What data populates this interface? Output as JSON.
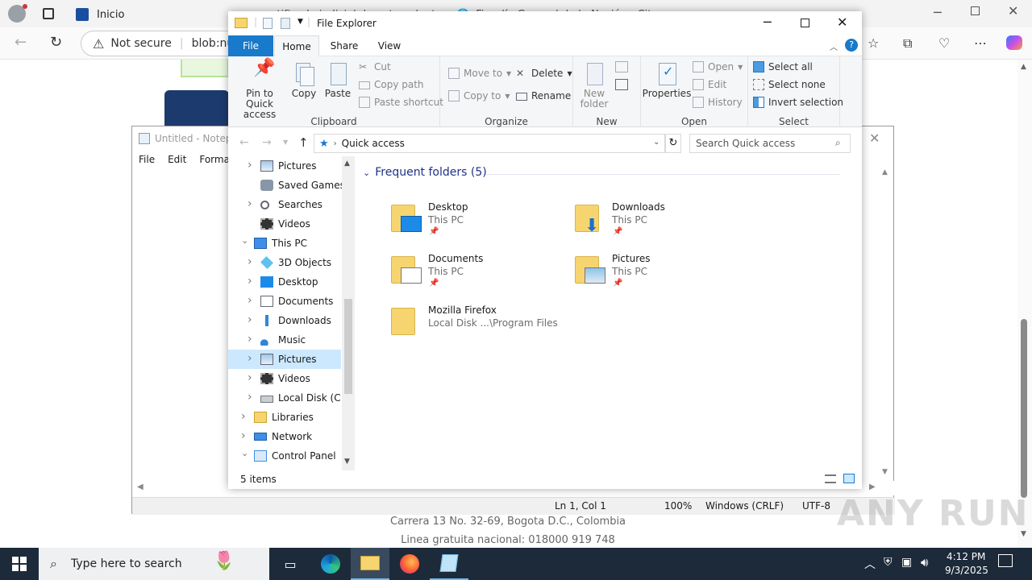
{
  "browser": {
    "tabs": [
      {
        "label": "Inicio"
      },
      {
        "label": "ertificado judicial de antecedentes"
      },
      {
        "label": "Fiscalía General de la Nación - Cit"
      }
    ],
    "security_label": "Not secure",
    "url": "blob:nu",
    "page_footer": {
      "address": "Carrera 13 No. 32-69, Bogota D.C., Colombia",
      "phone": "Linea gratuita nacional: 018000 919 748"
    }
  },
  "notepad": {
    "title": "Untitled - Notepad",
    "menu": [
      "File",
      "Edit",
      "Format"
    ],
    "status": {
      "position": "Ln 1, Col 1",
      "zoom": "100%",
      "line_ending": "Windows (CRLF)",
      "encoding": "UTF-8"
    }
  },
  "explorer": {
    "title": "File Explorer",
    "ribbon_tabs": [
      "File",
      "Home",
      "Share",
      "View"
    ],
    "active_tab": "Home",
    "ribbon": {
      "clipboard": {
        "title": "Clipboard",
        "pin": "Pin to Quick access",
        "copy": "Copy",
        "paste": "Paste",
        "cut": "Cut",
        "copy_path": "Copy path",
        "paste_shortcut": "Paste shortcut"
      },
      "organize": {
        "title": "Organize",
        "move_to": "Move to",
        "copy_to": "Copy to",
        "delete": "Delete",
        "rename": "Rename"
      },
      "new": {
        "title": "New",
        "new_folder": "New folder"
      },
      "open": {
        "title": "Open",
        "properties": "Properties",
        "open": "Open",
        "edit": "Edit",
        "history": "History"
      },
      "select": {
        "title": "Select",
        "select_all": "Select all",
        "select_none": "Select none",
        "invert": "Invert selection"
      }
    },
    "address": "Quick access",
    "search_placeholder": "Search Quick access",
    "nav_tree": [
      {
        "label": "Pictures",
        "icon": "pictures-icon",
        "level": 1
      },
      {
        "label": "Saved Games",
        "icon": "saved-games-icon",
        "level": 1
      },
      {
        "label": "Searches",
        "icon": "search-icon",
        "level": 1
      },
      {
        "label": "Videos",
        "icon": "videos-icon",
        "level": 1
      },
      {
        "label": "This PC",
        "icon": "computer-icon",
        "level": 0,
        "expanded": true
      },
      {
        "label": "3D Objects",
        "icon": "3d-objects-icon",
        "level": 1
      },
      {
        "label": "Desktop",
        "icon": "desktop-icon",
        "level": 1
      },
      {
        "label": "Documents",
        "icon": "documents-icon",
        "level": 1
      },
      {
        "label": "Downloads",
        "icon": "downloads-icon",
        "level": 1
      },
      {
        "label": "Music",
        "icon": "music-icon",
        "level": 1
      },
      {
        "label": "Pictures",
        "icon": "pictures-icon",
        "level": 1,
        "selected": true
      },
      {
        "label": "Videos",
        "icon": "videos-icon",
        "level": 1
      },
      {
        "label": "Local Disk (C:)",
        "icon": "local-disk-icon",
        "level": 1
      },
      {
        "label": "Libraries",
        "icon": "libraries-icon",
        "level": 0
      },
      {
        "label": "Network",
        "icon": "network-icon",
        "level": 0
      },
      {
        "label": "Control Panel",
        "icon": "control-panel-icon",
        "level": 0,
        "expanded": true
      }
    ],
    "section_header": "Frequent folders (5)",
    "folders": [
      {
        "name": "Desktop",
        "location": "This PC",
        "pinned": true,
        "overlay": "desktop"
      },
      {
        "name": "Downloads",
        "location": "This PC",
        "pinned": true,
        "overlay": "download"
      },
      {
        "name": "Documents",
        "location": "This PC",
        "pinned": true,
        "overlay": "document"
      },
      {
        "name": "Pictures",
        "location": "This PC",
        "pinned": true,
        "overlay": "picture"
      },
      {
        "name": "Mozilla Firefox",
        "location": "Local Disk ...\\Program Files",
        "pinned": false,
        "overlay": "none"
      }
    ],
    "status": "5 items"
  },
  "taskbar": {
    "search_placeholder": "Type here to search",
    "time": "4:12 PM",
    "date": "9/3/2025"
  },
  "watermark": "ANY RUN",
  "colors": {
    "accent": "#1979ca",
    "file_tab": "#1979ca",
    "selection": "#cce8ff",
    "folder": "#f6d570",
    "taskbar": "#1c2a3a"
  }
}
